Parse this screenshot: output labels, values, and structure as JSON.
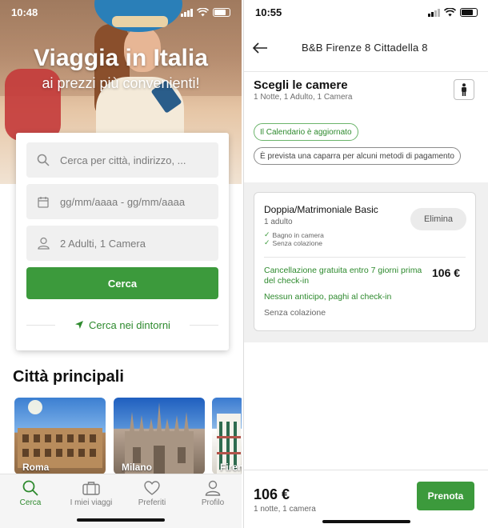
{
  "left": {
    "status": {
      "time": "10:48"
    },
    "hero": {
      "title": "Viaggia in Italia",
      "subtitle": "ai prezzi più convenienti!"
    },
    "search": {
      "destination_placeholder": "Cerca per città, indirizzo, ...",
      "dates_placeholder": "gg/mm/aaaa - gg/mm/aaaa",
      "guests_value": "2 Adulti, 1 Camera",
      "search_button": "Cerca",
      "nearby_link": "Cerca nei dintorni"
    },
    "cities": {
      "title": "Città principali",
      "items": [
        {
          "label": "Roma"
        },
        {
          "label": "Milano"
        },
        {
          "label": "Firen"
        }
      ]
    },
    "tabbar": {
      "items": [
        {
          "label": "Cerca",
          "icon": "search-icon",
          "active": true
        },
        {
          "label": "I miei viaggi",
          "icon": "suitcase-icon"
        },
        {
          "label": "Preferiti",
          "icon": "heart-icon"
        },
        {
          "label": "Profilo",
          "icon": "user-icon"
        }
      ]
    },
    "colors": {
      "accent": "#3c9a3c"
    }
  },
  "right": {
    "status": {
      "time": "10:55"
    },
    "nav": {
      "title": "B&B Firenze 8 Cittadella 8"
    },
    "rooms": {
      "title": "Scegli le camere",
      "subtitle": "1 Notte, 1 Adulto, 1 Camera",
      "chip_calendar": "Il Calendario è aggiornato",
      "chip_deposit": "È prevista una caparra per alcuni metodi di pagamento"
    },
    "room_card": {
      "name": "Doppia/Matrimoniale Basic",
      "occupancy": "1 adulto",
      "features": [
        "Bagno in camera",
        "Senza colazione"
      ],
      "remove_button": "Elimina",
      "cancellation": "Cancellazione gratuita entro 7 giorni prima del check-in",
      "price": "106 €",
      "payment": "Nessun anticipo, paghi al check-in",
      "board": "Senza colazione"
    },
    "footer": {
      "total": "106 €",
      "summary": "1 notte, 1 camera",
      "book_button": "Prenota"
    }
  }
}
